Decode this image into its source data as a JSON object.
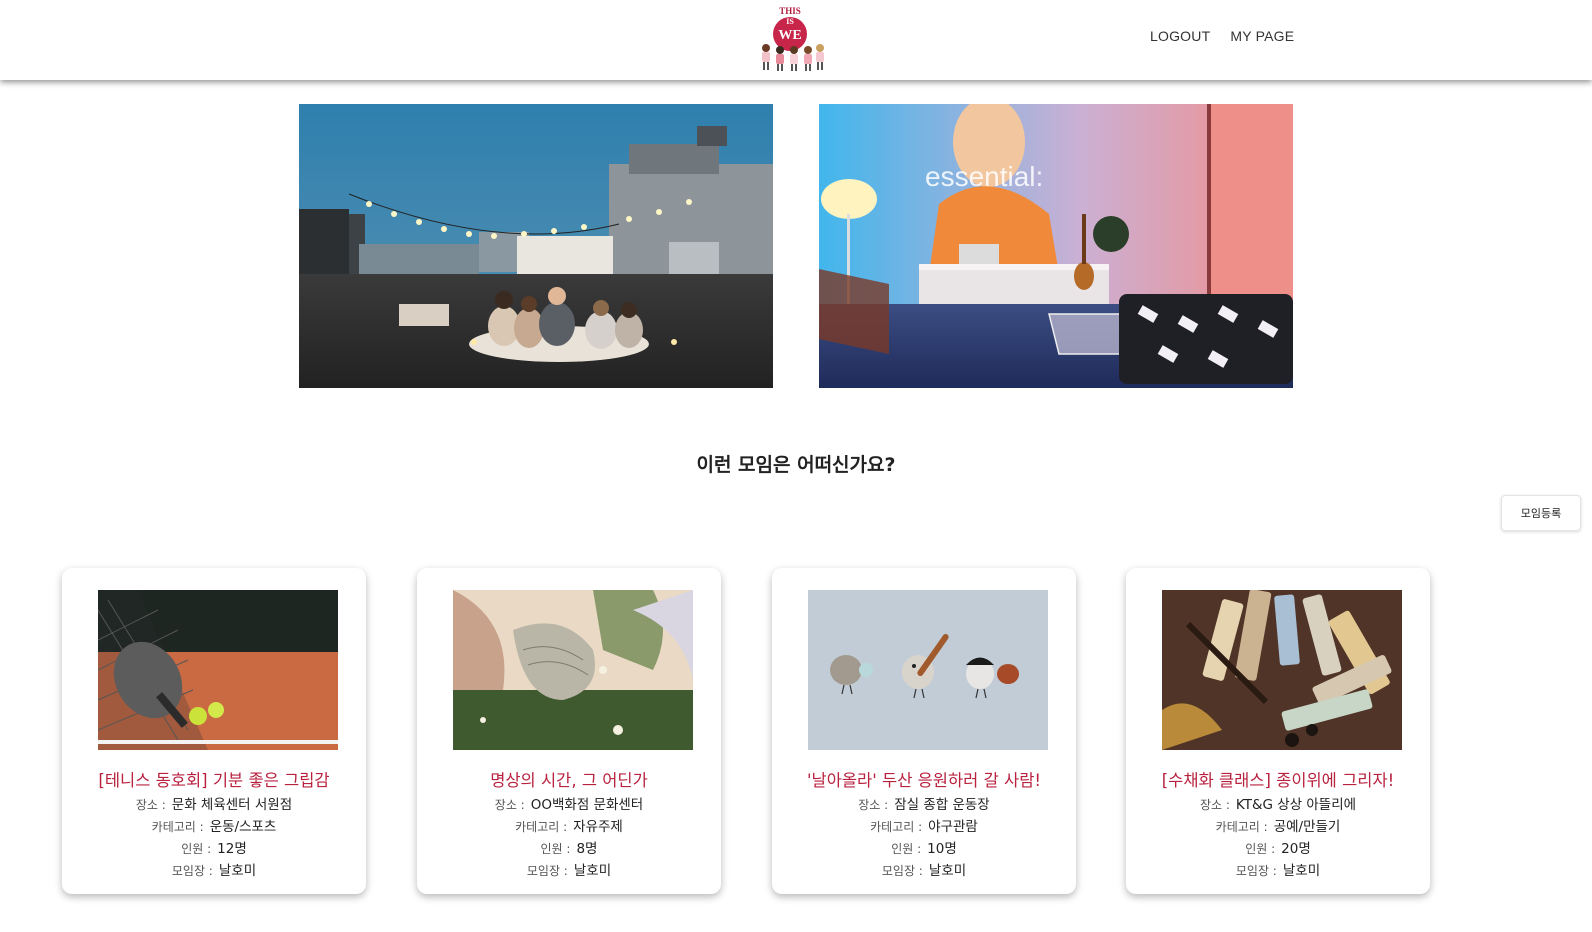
{
  "header": {
    "logo_text_top": "THIS",
    "logo_text_mid": "IS",
    "logo_text_main": "WE",
    "nav": [
      {
        "label": "LOGOUT"
      },
      {
        "label": "MY PAGE"
      }
    ]
  },
  "hero": {
    "right_image_text": "essential:"
  },
  "main": {
    "section_title": "이런 모임은 어떠신가요?",
    "register_button": "모임등록"
  },
  "labels": {
    "place": "장소 :",
    "category": "카테고리 :",
    "people": "인원 :",
    "leader": "모임장 :"
  },
  "cards": [
    {
      "title": "[테니스 동호회] 기분 좋은 그립감",
      "place": "문화 체육센터 서원점",
      "category": "운동/스포츠",
      "people": "12명",
      "leader": "날호미"
    },
    {
      "title": "명상의 시간, 그 어딘가",
      "place": "OO백화점 문화센터",
      "category": "자유주제",
      "people": "8명",
      "leader": "날호미"
    },
    {
      "title": "'날아올라' 두산 응원하러 갈 사람!",
      "place": "잠실 종합 운동장",
      "category": "야구관람",
      "people": "10명",
      "leader": "날호미"
    },
    {
      "title": "[수채화 클래스] 종이위에 그리자!",
      "place": "KT&G 상상 아뜰리에",
      "category": "공예/만들기",
      "people": "20명",
      "leader": "날호미"
    }
  ],
  "colors": {
    "accent": "#b8223f",
    "logo_circle": "#c8254a"
  }
}
